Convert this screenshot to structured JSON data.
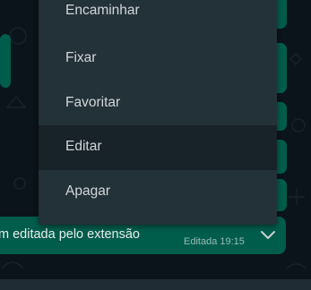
{
  "context_menu": {
    "items": [
      {
        "label": "Encaminhar"
      },
      {
        "label": "Fixar"
      },
      {
        "label": "Favoritar"
      },
      {
        "label": "Editar",
        "highlighted": true
      },
      {
        "label": "Apagar"
      }
    ]
  },
  "message": {
    "text": "m editada pelo extensão",
    "status": "Editada 19:15",
    "menu_icon": "chevron-down-icon"
  },
  "colors": {
    "chat_background": "#0b141a",
    "outgoing_bubble": "#005c4b",
    "menu_background": "#233138",
    "menu_item_hover": "#182229",
    "menu_text": "#d1d7db"
  }
}
